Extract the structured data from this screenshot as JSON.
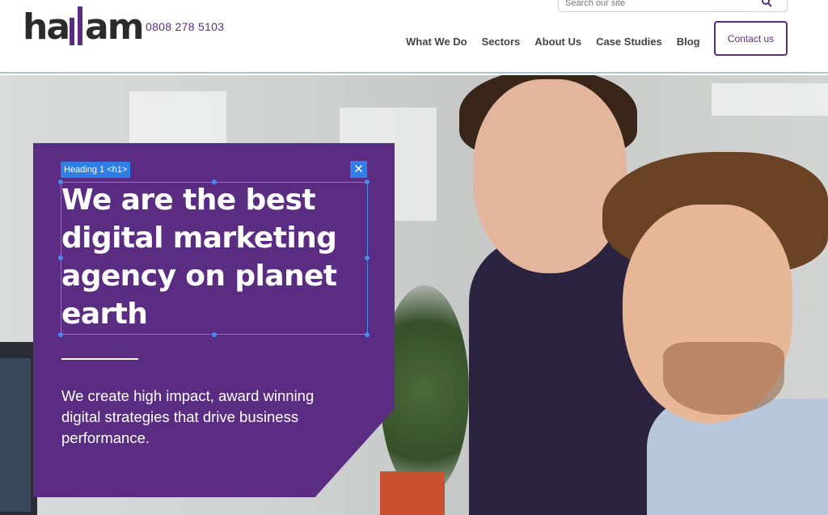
{
  "header": {
    "logo_text": "hallam",
    "phone": "0808 278 5103",
    "search_placeholder": "Search our site",
    "nav": [
      {
        "label": "What We Do"
      },
      {
        "label": "Sectors"
      },
      {
        "label": "About Us"
      },
      {
        "label": "Case Studies"
      },
      {
        "label": "Blog"
      }
    ],
    "contact_label": "Contact us"
  },
  "editor_overlay": {
    "tag_label": "Heading 1 <h1>",
    "close_icon": "close-icon"
  },
  "hero": {
    "heading": "We are the best digital marketing agency on planet earth",
    "subheading": "We create high impact, award winning digital strategies that drive business performance."
  },
  "colors": {
    "brand_purple": "#5a2d82",
    "selection_blue": "#2f7fe6"
  }
}
